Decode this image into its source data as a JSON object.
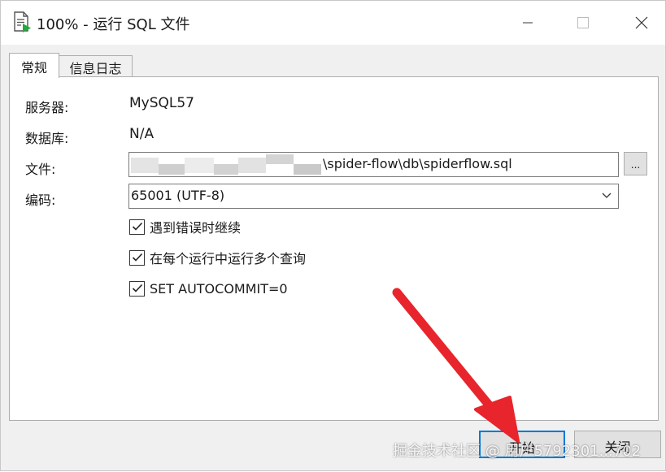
{
  "window": {
    "title": "100% - 运行 SQL 文件"
  },
  "tabs": [
    {
      "label": "常规",
      "active": true
    },
    {
      "label": "信息日志",
      "active": false
    }
  ],
  "form": {
    "server_label": "服务器:",
    "server_value": "MySQL57",
    "database_label": "数据库:",
    "database_value": "N/A",
    "file_label": "文件:",
    "file_value": "\\spider-flow\\db\\spiderflow.sql",
    "browse_label": "...",
    "encoding_label": "编码:",
    "encoding_value": "65001 (UTF-8)"
  },
  "options": [
    {
      "label": "遇到错误时继续",
      "checked": true
    },
    {
      "label": "在每个运行中运行多个查询",
      "checked": true
    },
    {
      "label": "SET AUTOCOMMIT=0",
      "checked": true
    }
  ],
  "buttons": {
    "start_label": "开始",
    "close_label": "关闭"
  },
  "watermark": "掘金技术社区 @ 用户5792301...702",
  "colors": {
    "accent": "#0078d7",
    "arrow": "#e8242c",
    "icon_green": "#22a93b"
  }
}
